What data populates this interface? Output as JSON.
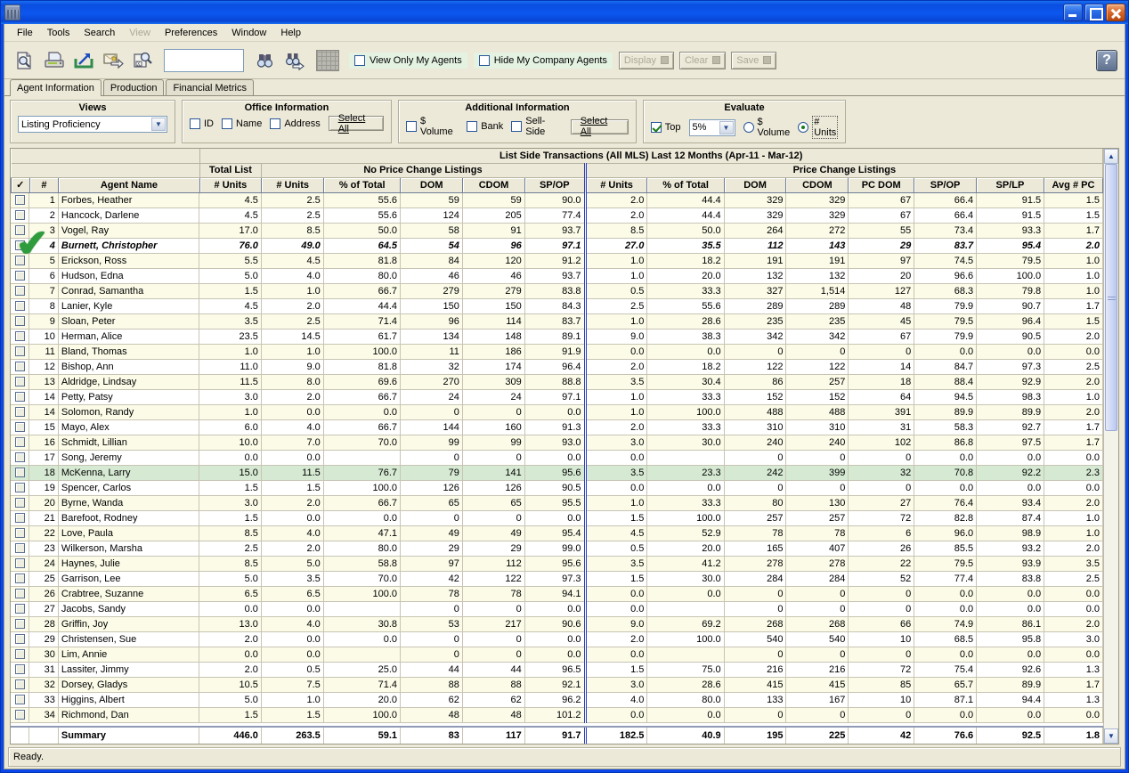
{
  "window": {
    "title": "",
    "app_icon": "building-icon",
    "minimize_label": "Minimize",
    "maximize_label": "Maximize",
    "close_label": "Close"
  },
  "menu": [
    {
      "label": "File",
      "enabled": true
    },
    {
      "label": "Tools",
      "enabled": true
    },
    {
      "label": "Search",
      "enabled": true
    },
    {
      "label": "View",
      "enabled": false
    },
    {
      "label": "Preferences",
      "enabled": true
    },
    {
      "label": "Window",
      "enabled": true
    },
    {
      "label": "Help",
      "enabled": true
    }
  ],
  "toolbar": {
    "icons": [
      {
        "name": "print-preview-icon"
      },
      {
        "name": "print-icon"
      },
      {
        "name": "export-icon"
      },
      {
        "name": "export-email-icon"
      },
      {
        "name": "excel-search-icon"
      },
      {
        "name": "binoculars-icon"
      },
      {
        "name": "binoculars-next-icon"
      },
      {
        "name": "grid-icon"
      }
    ],
    "search_value": "",
    "search_placeholder": "",
    "view_only_my_agents": {
      "label": "View Only My Agents",
      "checked": false
    },
    "hide_my_company_agents": {
      "label": "Hide My Company Agents",
      "checked": false
    },
    "display_label": "Display",
    "clear_label": "Clear",
    "save_label": "Save",
    "help_label": "?"
  },
  "tabs": [
    {
      "label": "Agent Information",
      "active": true
    },
    {
      "label": "Production",
      "active": false
    },
    {
      "label": "Financial Metrics",
      "active": false
    }
  ],
  "filters": {
    "views": {
      "title": "Views",
      "selected": "Listing Proficiency"
    },
    "office_information": {
      "title": "Office Information",
      "checks": [
        {
          "label": "ID",
          "checked": false
        },
        {
          "label": "Name",
          "checked": false
        },
        {
          "label": "Address",
          "checked": false
        }
      ],
      "select_all": "Select All"
    },
    "additional_information": {
      "title": "Additional Information",
      "checks": [
        {
          "label": "$ Volume",
          "checked": false
        },
        {
          "label": "Bank",
          "checked": false
        },
        {
          "label": "Sell-Side",
          "checked": false
        }
      ],
      "select_all": "Select All"
    },
    "evaluate": {
      "title": "Evaluate",
      "top": {
        "label": "Top",
        "checked": true
      },
      "top_percent": "5%",
      "dollar_volume": {
        "label": "$ Volume",
        "selected": false
      },
      "units": {
        "label": "# Units",
        "selected": true
      }
    }
  },
  "grid": {
    "banner": "List Side Transactions (All MLS) Last 12 Months (Apr-11 - Mar-12)",
    "group_headers": [
      {
        "label": "Total List"
      },
      {
        "label": "No Price Change Listings"
      },
      {
        "label": "Price Change Listings"
      }
    ],
    "columns": [
      "✓",
      "#",
      "Agent Name",
      "# Units",
      "# Units",
      "% of Total",
      "DOM",
      "CDOM",
      "SP/OP",
      "# Units",
      "% of Total",
      "DOM",
      "CDOM",
      "PC DOM",
      "SP/OP",
      "SP/LP",
      "Avg # PC"
    ],
    "rows": [
      {
        "n": "1",
        "name": "Forbes, Heather",
        "style": "alt",
        "v": [
          "4.5",
          "2.5",
          "55.6",
          "59",
          "59",
          "90.0",
          "2.0",
          "44.4",
          "329",
          "329",
          "67",
          "66.4",
          "91.5",
          "1.5"
        ]
      },
      {
        "n": "2",
        "name": "Hancock, Darlene",
        "style": "plain",
        "v": [
          "4.5",
          "2.5",
          "55.6",
          "124",
          "205",
          "77.4",
          "2.0",
          "44.4",
          "329",
          "329",
          "67",
          "66.4",
          "91.5",
          "1.5"
        ]
      },
      {
        "n": "3",
        "name": "Vogel, Ray",
        "style": "alt",
        "v": [
          "17.0",
          "8.5",
          "50.0",
          "58",
          "91",
          "93.7",
          "8.5",
          "50.0",
          "264",
          "272",
          "55",
          "73.4",
          "93.3",
          "1.7"
        ]
      },
      {
        "n": "4",
        "name": "Burnett, Christopher",
        "style": "bold",
        "v": [
          "76.0",
          "49.0",
          "64.5",
          "54",
          "96",
          "97.1",
          "27.0",
          "35.5",
          "112",
          "143",
          "29",
          "83.7",
          "95.4",
          "2.0"
        ]
      },
      {
        "n": "5",
        "name": "Erickson, Ross",
        "style": "alt",
        "v": [
          "5.5",
          "4.5",
          "81.8",
          "84",
          "120",
          "91.2",
          "1.0",
          "18.2",
          "191",
          "191",
          "97",
          "74.5",
          "79.5",
          "1.0"
        ]
      },
      {
        "n": "6",
        "name": "Hudson, Edna",
        "style": "plain",
        "v": [
          "5.0",
          "4.0",
          "80.0",
          "46",
          "46",
          "93.7",
          "1.0",
          "20.0",
          "132",
          "132",
          "20",
          "96.6",
          "100.0",
          "1.0"
        ]
      },
      {
        "n": "7",
        "name": "Conrad, Samantha",
        "style": "alt",
        "v": [
          "1.5",
          "1.0",
          "66.7",
          "279",
          "279",
          "83.8",
          "0.5",
          "33.3",
          "327",
          "1,514",
          "127",
          "68.3",
          "79.8",
          "1.0"
        ]
      },
      {
        "n": "8",
        "name": "Lanier, Kyle",
        "style": "plain",
        "v": [
          "4.5",
          "2.0",
          "44.4",
          "150",
          "150",
          "84.3",
          "2.5",
          "55.6",
          "289",
          "289",
          "48",
          "79.9",
          "90.7",
          "1.7"
        ]
      },
      {
        "n": "9",
        "name": "Sloan, Peter",
        "style": "alt",
        "v": [
          "3.5",
          "2.5",
          "71.4",
          "96",
          "114",
          "83.7",
          "1.0",
          "28.6",
          "235",
          "235",
          "45",
          "79.5",
          "96.4",
          "1.5"
        ]
      },
      {
        "n": "10",
        "name": "Herman, Alice",
        "style": "plain",
        "v": [
          "23.5",
          "14.5",
          "61.7",
          "134",
          "148",
          "89.1",
          "9.0",
          "38.3",
          "342",
          "342",
          "67",
          "79.9",
          "90.5",
          "2.0"
        ]
      },
      {
        "n": "11",
        "name": "Bland, Thomas",
        "style": "alt",
        "v": [
          "1.0",
          "1.0",
          "100.0",
          "11",
          "186",
          "91.9",
          "0.0",
          "0.0",
          "0",
          "0",
          "0",
          "0.0",
          "0.0",
          "0.0"
        ]
      },
      {
        "n": "12",
        "name": "Bishop, Ann",
        "style": "plain",
        "v": [
          "11.0",
          "9.0",
          "81.8",
          "32",
          "174",
          "96.4",
          "2.0",
          "18.2",
          "122",
          "122",
          "14",
          "84.7",
          "97.3",
          "2.5"
        ]
      },
      {
        "n": "13",
        "name": "Aldridge, Lindsay",
        "style": "alt",
        "v": [
          "11.5",
          "8.0",
          "69.6",
          "270",
          "309",
          "88.8",
          "3.5",
          "30.4",
          "86",
          "257",
          "18",
          "88.4",
          "92.9",
          "2.0"
        ]
      },
      {
        "n": "14",
        "name": "Petty, Patsy",
        "style": "plain",
        "v": [
          "3.0",
          "2.0",
          "66.7",
          "24",
          "24",
          "97.1",
          "1.0",
          "33.3",
          "152",
          "152",
          "64",
          "94.5",
          "98.3",
          "1.0"
        ]
      },
      {
        "n": "14",
        "name": "Solomon, Randy",
        "style": "alt",
        "v": [
          "1.0",
          "0.0",
          "0.0",
          "0",
          "0",
          "0.0",
          "1.0",
          "100.0",
          "488",
          "488",
          "391",
          "89.9",
          "89.9",
          "2.0"
        ]
      },
      {
        "n": "15",
        "name": "Mayo, Alex",
        "style": "plain",
        "v": [
          "6.0",
          "4.0",
          "66.7",
          "144",
          "160",
          "91.3",
          "2.0",
          "33.3",
          "310",
          "310",
          "31",
          "58.3",
          "92.7",
          "1.7"
        ]
      },
      {
        "n": "16",
        "name": "Schmidt, Lillian",
        "style": "alt",
        "v": [
          "10.0",
          "7.0",
          "70.0",
          "99",
          "99",
          "93.0",
          "3.0",
          "30.0",
          "240",
          "240",
          "102",
          "86.8",
          "97.5",
          "1.7"
        ]
      },
      {
        "n": "17",
        "name": "Song, Jeremy",
        "style": "plain",
        "v": [
          "0.0",
          "0.0",
          "",
          "0",
          "0",
          "0.0",
          "0.0",
          "",
          "0",
          "0",
          "0",
          "0.0",
          "0.0",
          "0.0"
        ]
      },
      {
        "n": "18",
        "name": "McKenna, Larry",
        "style": "green",
        "v": [
          "15.0",
          "11.5",
          "76.7",
          "79",
          "141",
          "95.6",
          "3.5",
          "23.3",
          "242",
          "399",
          "32",
          "70.8",
          "92.2",
          "2.3"
        ]
      },
      {
        "n": "19",
        "name": "Spencer, Carlos",
        "style": "plain",
        "v": [
          "1.5",
          "1.5",
          "100.0",
          "126",
          "126",
          "90.5",
          "0.0",
          "0.0",
          "0",
          "0",
          "0",
          "0.0",
          "0.0",
          "0.0"
        ]
      },
      {
        "n": "20",
        "name": "Byrne, Wanda",
        "style": "alt",
        "v": [
          "3.0",
          "2.0",
          "66.7",
          "65",
          "65",
          "95.5",
          "1.0",
          "33.3",
          "80",
          "130",
          "27",
          "76.4",
          "93.4",
          "2.0"
        ]
      },
      {
        "n": "21",
        "name": "Barefoot, Rodney",
        "style": "plain",
        "v": [
          "1.5",
          "0.0",
          "0.0",
          "0",
          "0",
          "0.0",
          "1.5",
          "100.0",
          "257",
          "257",
          "72",
          "82.8",
          "87.4",
          "1.0"
        ]
      },
      {
        "n": "22",
        "name": "Love, Paula",
        "style": "alt",
        "v": [
          "8.5",
          "4.0",
          "47.1",
          "49",
          "49",
          "95.4",
          "4.5",
          "52.9",
          "78",
          "78",
          "6",
          "96.0",
          "98.9",
          "1.0"
        ]
      },
      {
        "n": "23",
        "name": "Wilkerson, Marsha",
        "style": "plain",
        "v": [
          "2.5",
          "2.0",
          "80.0",
          "29",
          "29",
          "99.0",
          "0.5",
          "20.0",
          "165",
          "407",
          "26",
          "85.5",
          "93.2",
          "2.0"
        ]
      },
      {
        "n": "24",
        "name": "Haynes, Julie",
        "style": "alt",
        "v": [
          "8.5",
          "5.0",
          "58.8",
          "97",
          "112",
          "95.6",
          "3.5",
          "41.2",
          "278",
          "278",
          "22",
          "79.5",
          "93.9",
          "3.5"
        ]
      },
      {
        "n": "25",
        "name": "Garrison, Lee",
        "style": "plain",
        "v": [
          "5.0",
          "3.5",
          "70.0",
          "42",
          "122",
          "97.3",
          "1.5",
          "30.0",
          "284",
          "284",
          "52",
          "77.4",
          "83.8",
          "2.5"
        ]
      },
      {
        "n": "26",
        "name": "Crabtree, Suzanne",
        "style": "alt",
        "v": [
          "6.5",
          "6.5",
          "100.0",
          "78",
          "78",
          "94.1",
          "0.0",
          "0.0",
          "0",
          "0",
          "0",
          "0.0",
          "0.0",
          "0.0"
        ]
      },
      {
        "n": "27",
        "name": "Jacobs, Sandy",
        "style": "plain",
        "v": [
          "0.0",
          "0.0",
          "",
          "0",
          "0",
          "0.0",
          "0.0",
          "",
          "0",
          "0",
          "0",
          "0.0",
          "0.0",
          "0.0"
        ]
      },
      {
        "n": "28",
        "name": "Griffin, Joy",
        "style": "alt",
        "v": [
          "13.0",
          "4.0",
          "30.8",
          "53",
          "217",
          "90.6",
          "9.0",
          "69.2",
          "268",
          "268",
          "66",
          "74.9",
          "86.1",
          "2.0"
        ]
      },
      {
        "n": "29",
        "name": "Christensen, Sue",
        "style": "plain",
        "v": [
          "2.0",
          "0.0",
          "0.0",
          "0",
          "0",
          "0.0",
          "2.0",
          "100.0",
          "540",
          "540",
          "10",
          "68.5",
          "95.8",
          "3.0"
        ]
      },
      {
        "n": "30",
        "name": "Lim, Annie",
        "style": "alt",
        "v": [
          "0.0",
          "0.0",
          "",
          "0",
          "0",
          "0.0",
          "0.0",
          "",
          "0",
          "0",
          "0",
          "0.0",
          "0.0",
          "0.0"
        ]
      },
      {
        "n": "31",
        "name": "Lassiter, Jimmy",
        "style": "plain",
        "v": [
          "2.0",
          "0.5",
          "25.0",
          "44",
          "44",
          "96.5",
          "1.5",
          "75.0",
          "216",
          "216",
          "72",
          "75.4",
          "92.6",
          "1.3"
        ]
      },
      {
        "n": "32",
        "name": "Dorsey, Gladys",
        "style": "alt",
        "v": [
          "10.5",
          "7.5",
          "71.4",
          "88",
          "88",
          "92.1",
          "3.0",
          "28.6",
          "415",
          "415",
          "85",
          "65.7",
          "89.9",
          "1.7"
        ]
      },
      {
        "n": "33",
        "name": "Higgins, Albert",
        "style": "plain",
        "v": [
          "5.0",
          "1.0",
          "20.0",
          "62",
          "62",
          "96.2",
          "4.0",
          "80.0",
          "133",
          "167",
          "10",
          "87.1",
          "94.4",
          "1.3"
        ]
      },
      {
        "n": "34",
        "name": "Richmond, Dan",
        "style": "alt",
        "v": [
          "1.5",
          "1.5",
          "100.0",
          "48",
          "48",
          "101.2",
          "0.0",
          "0.0",
          "0",
          "0",
          "0",
          "0.0",
          "0.0",
          "0.0"
        ]
      }
    ],
    "summary": {
      "label": "Summary",
      "v": [
        "446.0",
        "263.5",
        "59.1",
        "83",
        "117",
        "91.7",
        "182.5",
        "40.9",
        "195",
        "225",
        "42",
        "76.6",
        "92.5",
        "1.8"
      ]
    },
    "selected_row_index": 4,
    "selection_marker": "green-checkmark"
  },
  "status": {
    "text": "Ready."
  }
}
